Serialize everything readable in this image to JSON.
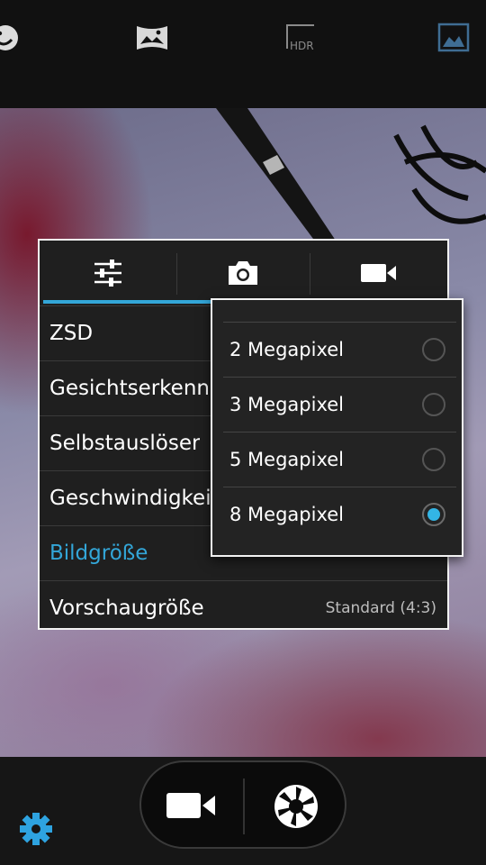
{
  "colors": {
    "accent": "#33a6d8",
    "radio_on": "#33b5e5",
    "panel_bg": "#1f1f1f"
  },
  "top_modes": [
    {
      "icon": "face-beauty-icon"
    },
    {
      "icon": "panorama-icon"
    },
    {
      "icon": "hdr-icon",
      "label": "HDR"
    },
    {
      "icon": "scene-image-icon"
    }
  ],
  "settings_panel": {
    "tabs": [
      {
        "icon": "sliders-icon"
      },
      {
        "icon": "camera-icon"
      },
      {
        "icon": "video-camera-icon"
      }
    ],
    "rows": [
      {
        "label": "ZSD"
      },
      {
        "label": "Gesichtserkennung"
      },
      {
        "label": "Selbstauslöser"
      },
      {
        "label": "Geschwindigkeit"
      },
      {
        "label": "Bildgröße"
      },
      {
        "label": "Vorschaugröße",
        "value": "Standard (4:3)"
      }
    ]
  },
  "picture_size_popup": {
    "options": [
      {
        "label": "2 Megapixel",
        "selected": false
      },
      {
        "label": "3 Megapixel",
        "selected": false
      },
      {
        "label": "5 Megapixel",
        "selected": false
      },
      {
        "label": "8 Megapixel",
        "selected": true
      }
    ]
  },
  "bottom_bar": {
    "video_button_icon": "video-camera-icon",
    "shutter_button_icon": "shutter-aperture-icon",
    "settings_icon": "gear-icon"
  }
}
